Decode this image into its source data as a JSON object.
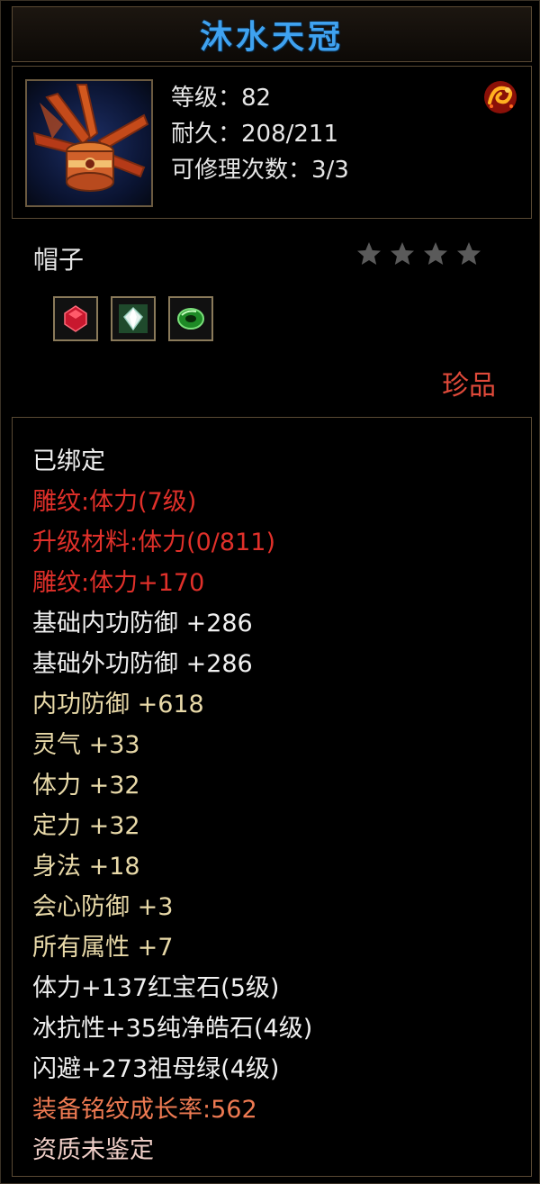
{
  "title": "沐水天冠",
  "header": {
    "level_text": "等级：82",
    "durability_text": "耐久：208/211",
    "repair_text": "可修理次数：3/3"
  },
  "item_type": "帽子",
  "stars": {
    "filled": 0,
    "total": 4
  },
  "gems": [
    {
      "name": "ruby-gem-icon",
      "color": "#d8243a"
    },
    {
      "name": "diamond-gem-icon",
      "color": "#d8e8e0"
    },
    {
      "name": "emerald-gem-icon",
      "color": "#34b83a"
    }
  ],
  "quality": "珍品",
  "attributes": [
    {
      "text": "已绑定",
      "color": "white"
    },
    {
      "text": "雕纹:体力(7级)",
      "color": "red"
    },
    {
      "text": "升级材料:体力(0/811)",
      "color": "red"
    },
    {
      "text": "雕纹:体力+170",
      "color": "red"
    },
    {
      "text": "基础内功防御 +286",
      "color": "white"
    },
    {
      "text": "基础外功防御 +286",
      "color": "white"
    },
    {
      "text": "内功防御 +618",
      "color": "gold"
    },
    {
      "text": "灵气 +33",
      "color": "gold"
    },
    {
      "text": "体力 +32",
      "color": "gold"
    },
    {
      "text": "定力 +32",
      "color": "gold"
    },
    {
      "text": "身法 +18",
      "color": "gold"
    },
    {
      "text": "会心防御 +3",
      "color": "gold"
    },
    {
      "text": "所有属性 +7",
      "color": "gold"
    },
    {
      "text": "体力+137红宝石(5级)",
      "color": "white"
    },
    {
      "text": "冰抗性+35纯净皓石(4级)",
      "color": "white"
    },
    {
      "text": "闪避+273祖母绿(4级)",
      "color": "white"
    },
    {
      "text": "装备铭纹成长率:562",
      "color": "orange"
    },
    {
      "text": "资质未鉴定",
      "color": "pink"
    }
  ]
}
